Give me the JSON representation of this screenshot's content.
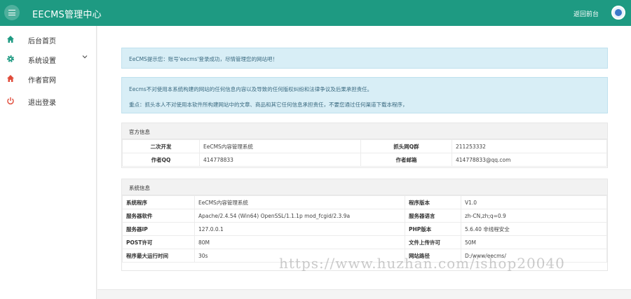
{
  "header": {
    "title": "EECMS管理中心",
    "back_link": "返回前台"
  },
  "sidebar": {
    "items": [
      {
        "label": "后台首页",
        "icon": "home-icon",
        "color": "#1e9a82"
      },
      {
        "label": "系统设置",
        "icon": "gear-icon",
        "color": "#1e9a82"
      },
      {
        "label": "作者官网",
        "icon": "home-icon",
        "color": "#e04b3a"
      },
      {
        "label": "退出登录",
        "icon": "power-icon",
        "color": "#e04b3a"
      }
    ]
  },
  "alerts": {
    "welcome": "EeCMS提示您：账号'eecms'登录成功，尽情管理您的网站吧！",
    "disclaimer_1": "Eecms不对使用本系统构建的网站的任何信息内容以及导致的任何版权纠纷和法律争议及后果承担责任。",
    "disclaimer_2": "重点：抓头本人不对使用本软件所构建网站中的文章、商品和其它任何信息承担责任，不要您通过任何渠道下载本程序，"
  },
  "official": {
    "title": "官方信息",
    "row1": {
      "k1": "二次开发",
      "v1": "EeCMS内容管理系统",
      "k2": "抓头网Q群",
      "v2": "211253332"
    },
    "row2": {
      "k1": "作者QQ",
      "v1": "414778833",
      "k2": "作者邮箱",
      "v2": "414778833@qq.com"
    }
  },
  "system": {
    "title": "系统信息",
    "rows": [
      {
        "k1": "系统程序",
        "v1": "EeCMS内容管理系统",
        "k2": "程序版本",
        "v2": "V1.0"
      },
      {
        "k1": "服务器软件",
        "v1": "Apache/2.4.54 (Win64) OpenSSL/1.1.1p mod_fcgid/2.3.9a",
        "k2": "服务器语言",
        "v2": "zh-CN,zh;q=0.9"
      },
      {
        "k1": "服务器IP",
        "v1": "127.0.0.1",
        "k2": "PHP版本",
        "v2": "5.6.40 非线程安全"
      },
      {
        "k1": "POST许可",
        "v1": "80M",
        "k2": "文件上传许可",
        "v2": "50M"
      },
      {
        "k1": "程序最大运行时间",
        "v1": "30s",
        "k2": "网站路径",
        "v2": "D:/www/eecms/"
      }
    ]
  },
  "watermark": "https://www.huzhan.com/ishop20040",
  "colors": {
    "brand": "#1e9a82",
    "alert_bg": "#d8eef6"
  }
}
